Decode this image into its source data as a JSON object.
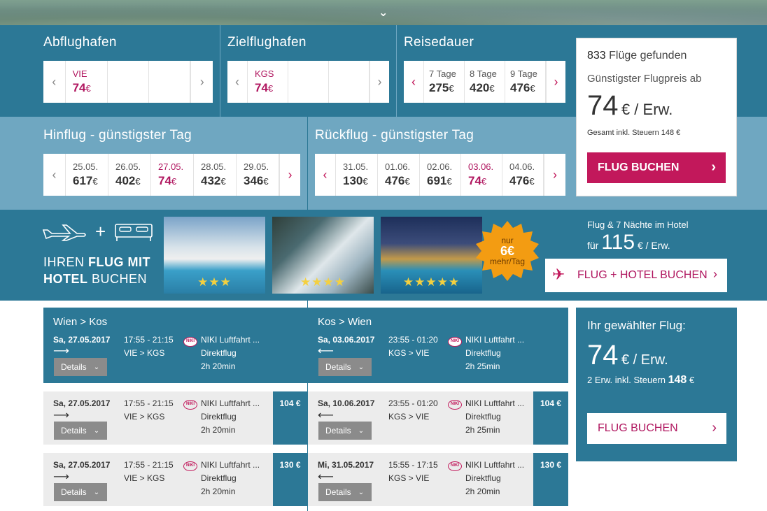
{
  "hero": {
    "chevron": "⌄"
  },
  "search": {
    "origin": {
      "title": "Abflughafen",
      "cells": [
        {
          "code": "VIE",
          "price": "74",
          "cur": "€"
        }
      ]
    },
    "destination": {
      "title": "Zielflughafen",
      "cells": [
        {
          "code": "KGS",
          "price": "74",
          "cur": "€"
        }
      ]
    },
    "duration": {
      "title": "Reisedauer",
      "cells": [
        {
          "label": "7 Tage",
          "price": "275",
          "cur": "€"
        },
        {
          "label": "8 Tage",
          "price": "420",
          "cur": "€"
        },
        {
          "label": "9 Tage",
          "price": "476",
          "cur": "€"
        }
      ]
    }
  },
  "outbound": {
    "title": "Hinflug - günstigster Tag",
    "days": [
      {
        "date": "25.05.",
        "price": "617",
        "cur": "€"
      },
      {
        "date": "26.05.",
        "price": "402",
        "cur": "€"
      },
      {
        "date": "27.05.",
        "price": "74",
        "cur": "€"
      },
      {
        "date": "28.05.",
        "price": "432",
        "cur": "€"
      },
      {
        "date": "29.05.",
        "price": "346",
        "cur": "€"
      }
    ],
    "selected_index": 2
  },
  "return": {
    "title": "Rückflug - günstigster Tag",
    "days": [
      {
        "date": "31.05.",
        "price": "130",
        "cur": "€"
      },
      {
        "date": "01.06.",
        "price": "476",
        "cur": "€"
      },
      {
        "date": "02.06.",
        "price": "691",
        "cur": "€"
      },
      {
        "date": "03.06.",
        "price": "74",
        "cur": "€"
      },
      {
        "date": "04.06.",
        "price": "476",
        "cur": "€"
      }
    ],
    "selected_index": 3
  },
  "summary": {
    "count": "833",
    "found_label": "Flüge gefunden",
    "cheapest_label": "Günstigster Flugpreis ab",
    "price": "74",
    "unit": "€ / Erw.",
    "tax": "Gesamt inkl. Steuern 148 €",
    "book": "FLUG BUCHEN"
  },
  "hotel": {
    "text_1a": "IHREN ",
    "text_1b": "FLUG MIT",
    "text_2a": "HOTEL",
    "text_2b": " BUCHEN",
    "photos": [
      {
        "stars": "★★★"
      },
      {
        "stars": "★★★★"
      },
      {
        "stars": "★★★★★"
      }
    ],
    "badge_top": "nur",
    "badge_price": "6€",
    "badge_bottom": "mehr/Tag",
    "offer_title": "Flug & 7 Nächte im Hotel",
    "offer_prefix": "für",
    "offer_price": "115",
    "offer_unit": "€ / Erw.",
    "book": "FLUG + HOTEL BUCHEN"
  },
  "results": {
    "outbound_header": "Wien > Kos",
    "return_header": "Kos > Wien",
    "details_label": "Details",
    "airline_logo": "NIKI",
    "selected_out": {
      "date": "Sa, 27.05.2017",
      "time": "17:55 - 21:15",
      "route": "VIE > KGS",
      "airline": "NIKI Luftfahrt ...",
      "type": "Direktflug",
      "duration": "2h 20min"
    },
    "selected_ret": {
      "date": "Sa, 03.06.2017",
      "time": "23:55 - 01:20",
      "route": "KGS > VIE",
      "airline": "NIKI Luftfahrt ...",
      "type": "Direktflug",
      "duration": "2h 25min"
    },
    "rows": [
      {
        "out": {
          "date": "Sa, 27.05.2017",
          "time": "17:55 - 21:15",
          "route": "VIE > KGS",
          "airline": "NIKI Luftfahrt ...",
          "type": "Direktflug",
          "duration": "2h 20min",
          "price": "104 €"
        },
        "ret": {
          "date": "Sa, 10.06.2017",
          "time": "23:55 - 01:20",
          "route": "KGS > VIE",
          "airline": "NIKI Luftfahrt ...",
          "type": "Direktflug",
          "duration": "2h 25min",
          "price": "104 €"
        }
      },
      {
        "out": {
          "date": "Sa, 27.05.2017",
          "time": "17:55 - 21:15",
          "route": "VIE > KGS",
          "airline": "NIKI Luftfahrt ...",
          "type": "Direktflug",
          "duration": "2h 20min",
          "price": "130 €"
        },
        "ret": {
          "date": "Mi, 31.05.2017",
          "time": "15:55 - 17:15",
          "route": "KGS > VIE",
          "airline": "NIKI Luftfahrt ...",
          "type": "Direktflug",
          "duration": "2h 20min",
          "price": "130 €"
        }
      }
    ]
  },
  "selected_panel": {
    "title": "Ihr gewählter Flug:",
    "price": "74",
    "unit": "€ / Erw.",
    "sub_prefix": "2 Erw. inkl. Steuern",
    "sub_value": "148",
    "sub_cur": "€",
    "book": "FLUG BUCHEN"
  },
  "colors": {
    "band_dark": "#2c7896",
    "band_light": "#6fa7c1",
    "accent": "#c2185b",
    "badge": "#f39c12"
  }
}
